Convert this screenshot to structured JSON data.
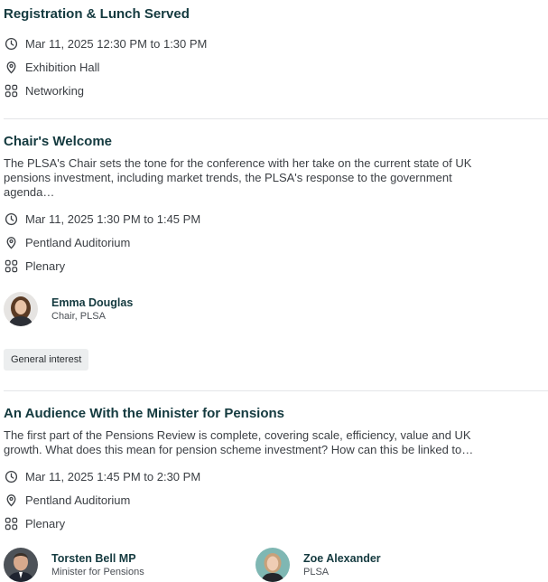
{
  "sessions": [
    {
      "title": "Registration & Lunch Served",
      "datetime": "Mar 11, 2025 12:30 PM to 1:30 PM",
      "location": "Exhibition Hall",
      "track": "Networking"
    },
    {
      "title": "Chair's Welcome",
      "description": "The PLSA's Chair sets the tone for the conference with her take on the current state of UK pensions investment, including market trends, the PLSA's response to the government agenda…",
      "datetime": "Mar 11, 2025 1:30 PM to 1:45 PM",
      "location": "Pentland Auditorium",
      "track": "Plenary",
      "speakers": [
        {
          "name": "Emma Douglas",
          "role": "Chair, PLSA"
        }
      ],
      "tags": [
        "General interest"
      ]
    },
    {
      "title": "An Audience With the Minister for Pensions",
      "description": "The first part of the Pensions Review is complete, covering scale, efficiency, value and UK growth. What does this mean for pension scheme investment? How can this be linked to…",
      "datetime": "Mar 11, 2025 1:45 PM to 2:30 PM",
      "location": "Pentland Auditorium",
      "track": "Plenary",
      "speakers": [
        {
          "name": "Torsten Bell MP",
          "role": "Minister for Pensions"
        },
        {
          "name": "Zoe Alexander",
          "role": "PLSA"
        }
      ]
    }
  ]
}
